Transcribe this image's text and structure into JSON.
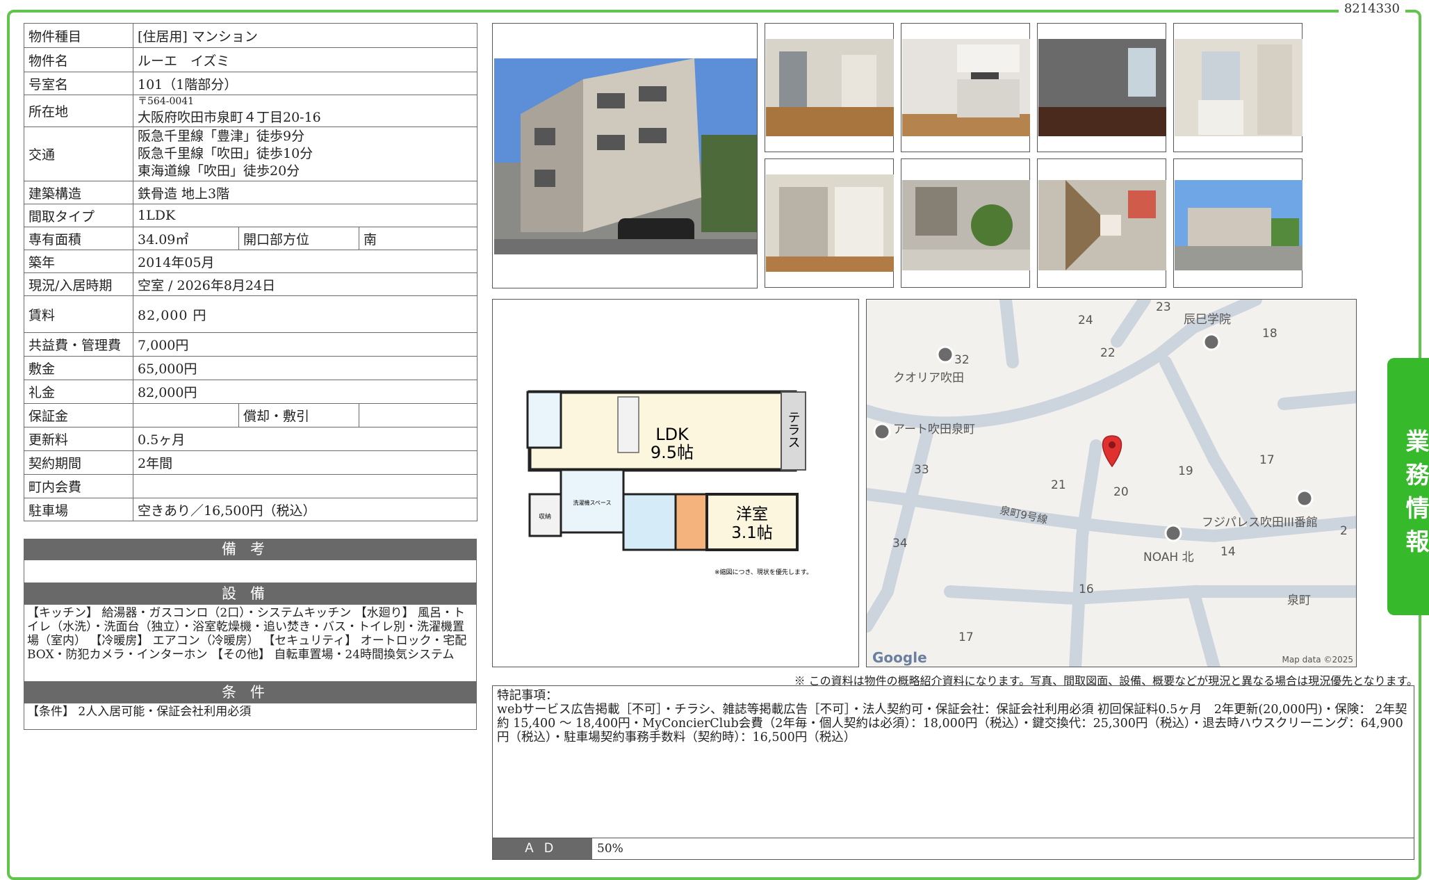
{
  "doc_id": "8214330",
  "side_tab": "業務情報",
  "rows": {
    "type_label": "物件種目",
    "type_value": "[住居用] マンション",
    "name_label": "物件名",
    "name_value": "ルーエ　イズミ",
    "room_label": "号室名",
    "room_value": "101（1階部分）",
    "address_label": "所在地",
    "postal": "〒564-0041",
    "address_value": "大阪府吹田市泉町４丁目20-16",
    "access_label": "交通",
    "access_1": "阪急千里線「豊津」徒歩9分",
    "access_2": "阪急千里線「吹田」徒歩10分",
    "access_3": "東海道線「吹田」徒歩20分",
    "structure_label": "建築構造",
    "structure_value": "鉄骨造 地上3階",
    "layout_label": "間取タイプ",
    "layout_value": "1LDK",
    "area_label": "専有面積",
    "area_value": "34.09㎡",
    "direction_label": "開口部方位",
    "direction_value": "南",
    "built_label": "築年",
    "built_value": "2014年05月",
    "status_label": "現況/入居時期",
    "status_value": "空室 / 2026年8月24日",
    "rent_label": "賃料",
    "rent_value": "82,000 円",
    "fee_label": "共益費・管理費",
    "fee_value": "7,000円",
    "deposit_label": "敷金",
    "deposit_value": "65,000円",
    "key_label": "礼金",
    "key_value": "82,000円",
    "guarantee_label": "保証金",
    "guarantee_value": "",
    "amort_label": "償却・敷引",
    "amort_value": "",
    "renewal_label": "更新料",
    "renewal_value": "0.5ヶ月",
    "contract_label": "契約期間",
    "contract_value": "2年間",
    "town_label": "町内会費",
    "town_value": "",
    "parking_label": "駐車場",
    "parking_value": "空きあり／16,500円（税込）"
  },
  "sections": {
    "notes_title": "備考",
    "notes_body": "",
    "equipment_title": "設備",
    "equipment_body": "【キッチン】 給湯器・ガスコンロ（2口）・システムキッチン 【水廻り】 風呂・トイレ（水洗）・洗面台（独立）・浴室乾燥機・追い焚き・バス・トイレ別・洗濯機置場（室内） 【冷暖房】 エアコン（冷暖房） 【セキュリティ】 オートロック・宅配BOX・防犯カメラ・インターホン 【その他】 自転車置場・24時間換気システム",
    "conditions_title": "条件",
    "conditions_body": "【条件】 2人入居可能・保証会社利用必須"
  },
  "floorplan": {
    "ldk_label": "LDK",
    "ldk_size": "9.5帖",
    "western_label": "洋室",
    "western_size": "3.1帖",
    "terrace_label": "テラス",
    "laundry_label": "洗濯機スペース",
    "storage_label": "収納",
    "note": "※縮図につき、現状を優先します。"
  },
  "map": {
    "labels": [
      "クオリア吹田",
      "アート吹田泉町",
      "辰巳学院",
      "フジパレス吹田III番館",
      "NOAH 北",
      "泉町9号線",
      "泉町"
    ],
    "numbers": [
      "23",
      "24",
      "18",
      "32",
      "22",
      "33",
      "21",
      "19",
      "17",
      "20",
      "34",
      "14",
      "2",
      "16",
      "17"
    ],
    "google": "Google",
    "attribution": "Map data ©2025"
  },
  "disclaimer": "※ この資料は物件の概略紹介資料になります。写真、間取図面、設備、概要などが現況と異なる場合は現況優先となります。",
  "remarks": {
    "title": "特記事項：",
    "body": "webサービス広告掲載［不可］・チラシ、雑誌等掲載広告［不可］・法人契約可・保証会社：保証会社利用必須 初回保証料0.5ヶ月　2年更新(20,000円)・保険： 2年契約 15,400 ～ 18,400円・MyConcierClub会費（2年毎・個人契約は必須）：18,000円（税込）・鍵交換代：25,300円（税込）・退去時ハウスクリーニング：64,900円（税込）・駐車場契約事務手数料（契約時）：16,500円（税込）",
    "ad_label": "ＡＤ",
    "ad_value": "50%"
  },
  "colors": {
    "frame": "#62c44d",
    "tab": "#37b92c",
    "header_gray": "#696969",
    "pin": "#e03131"
  }
}
